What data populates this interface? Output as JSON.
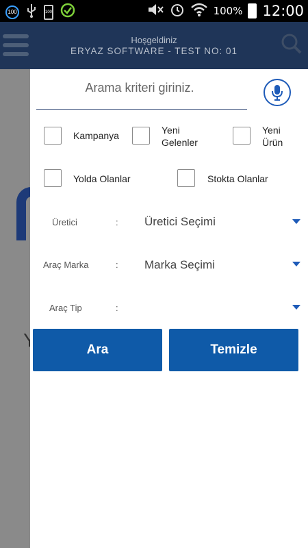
{
  "status_bar": {
    "notification_count": "100",
    "battery_small": "100",
    "battery_percent": "100%",
    "time": "12:00"
  },
  "app_bar": {
    "greeting": "Hoşgeldiniz",
    "subtitle": "ERYAZ SOFTWARE - TEST NO: 01"
  },
  "background": {
    "partial_letter": "Y"
  },
  "search": {
    "placeholder": "Arama kriteri giriniz."
  },
  "checkboxes": [
    {
      "label": "Kampanya",
      "checked": false
    },
    {
      "label": "Yeni Gelenler",
      "checked": false
    },
    {
      "label": "Yeni Ürün",
      "checked": false
    },
    {
      "label": "Yolda Olanlar",
      "checked": false
    },
    {
      "label": "Stokta Olanlar",
      "checked": false
    }
  ],
  "checkbox_lines": {
    "yeni_gelenler_1": "Yeni",
    "yeni_gelenler_2": "Gelenler",
    "yeni_urun_1": "Yeni",
    "yeni_urun_2": "Ürün"
  },
  "filters": {
    "manufacturer": {
      "label": "Üretici",
      "separator": ":",
      "value": "Üretici Seçimi"
    },
    "car_brand": {
      "label": "Araç Marka",
      "separator": ":",
      "value": "Marka Seçimi"
    },
    "car_type": {
      "label": "Araç Tip",
      "separator": ":",
      "value": ""
    }
  },
  "buttons": {
    "search": "Ara",
    "clear": "Temizle"
  },
  "colors": {
    "app_bar": "#1f3558",
    "accent": "#0f5aa8",
    "mic_ring": "#1e5bb8"
  },
  "icons": [
    "notification-count-icon",
    "usb-icon",
    "battery-small-icon",
    "check-circle-icon",
    "mute-icon",
    "alarm-icon",
    "wifi-icon",
    "battery-icon",
    "menu-icon",
    "search-icon",
    "microphone-icon"
  ]
}
